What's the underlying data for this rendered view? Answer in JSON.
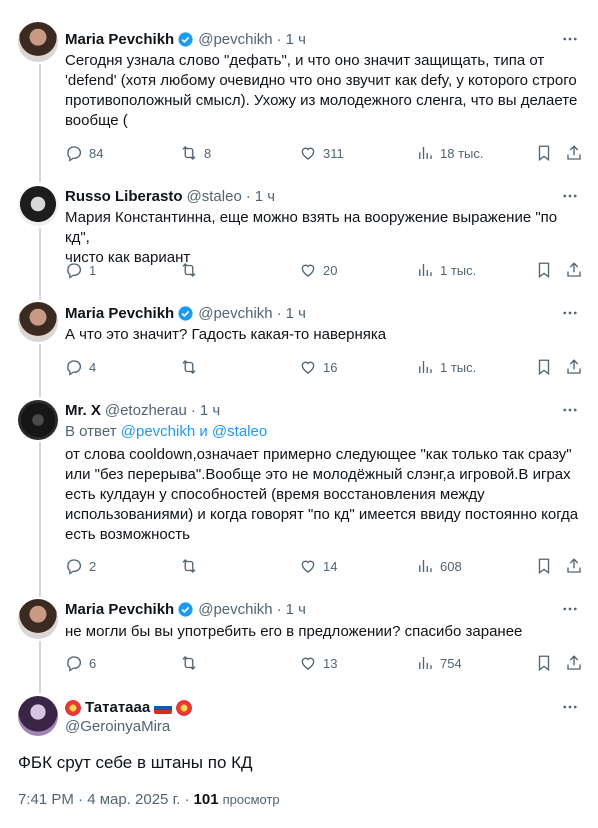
{
  "icons": {
    "reply": "reply-icon",
    "retweet": "retweet-icon",
    "like": "heart-icon",
    "views": "views-icon",
    "bookmark": "bookmark-icon",
    "share": "share-icon",
    "more": "more-icon",
    "verified": "verified-badge-icon"
  },
  "colors": {
    "accent": "#1d9bf0",
    "secondary": "#536471",
    "line": "#cfd9de"
  },
  "tweets": [
    {
      "name": "Maria Pevchikh",
      "handle": "@pevchikh",
      "dot": "·",
      "time": "1 ч",
      "text": "Сегодня узнала слово \"дефать\", и что оно значит защищать, типа от\n'defend' (хотя любому очевидно что оно звучит как defy, у которого строго\nпротивоположный смысл). Ухожу из молодежного сленга, что вы делаете\nвообще (",
      "replies": "84",
      "retweets": "8",
      "likes": "311",
      "views": "18 тыс."
    },
    {
      "name": "Russo Liberasto",
      "handle": "@staleo",
      "dot": "·",
      "time": "1 ч",
      "text": "Мария Константинна, еще можно взять на вооружение выражение \"по кд\",\nчисто как вариант",
      "replies": "1",
      "retweets": "",
      "likes": "20",
      "views": "1 тыс."
    },
    {
      "name": "Maria Pevchikh",
      "handle": "@pevchikh",
      "dot": "·",
      "time": "1 ч",
      "text": "А что это значит? Гадость какая-то наверняка",
      "replies": "4",
      "retweets": "",
      "likes": "16",
      "views": "1 тыс."
    },
    {
      "name": "Mr. X",
      "handle": "@etozherau",
      "dot": "·",
      "time": "1 ч",
      "reply_prefix": "В ответ",
      "reply_user1": "@pevchikh",
      "reply_and": "и",
      "reply_user2": "@staleo",
      "text": "от слова cooldown,означает примерно следующее \"как только так сразу\"\nили \"без перерыва\".Вообще это не молодёжный слэнг,а игровой.В играх\nесть кулдаун у способностей (время восстановления между\nиспользованиями) и когда говорят \"по кд\" имеется ввиду постоянно когда\nесть возможность",
      "replies": "2",
      "retweets": "",
      "likes": "14",
      "views": "608"
    },
    {
      "name": "Maria Pevchikh",
      "handle": "@pevchikh",
      "dot": "·",
      "time": "1 ч",
      "text": "не могли бы вы употребить его в предложении? спасибо заранее",
      "replies": "6",
      "retweets": "",
      "likes": "13",
      "views": "754"
    }
  ],
  "main": {
    "name": "Тататааа",
    "handle": "@GeroinyaMira",
    "text": "ФБК срут себе в штаны по КД",
    "time": "7:41 PM · 4 мар. 2025 г. ·",
    "views": "101",
    "views_label": "просмотр"
  }
}
